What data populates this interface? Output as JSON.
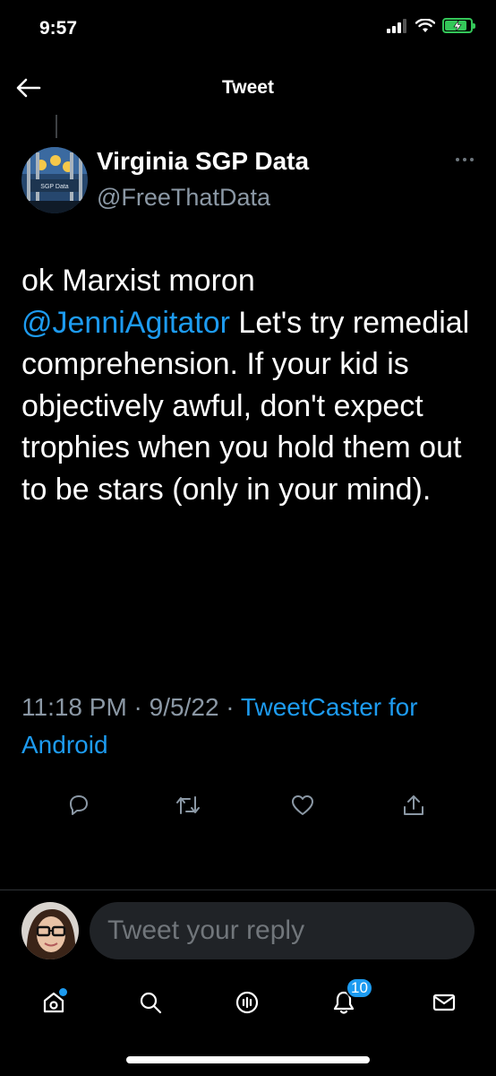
{
  "status_bar": {
    "time": "9:57",
    "icons": [
      "signal-icon",
      "wifi-icon",
      "battery-charging-icon"
    ],
    "battery_level": 0.8
  },
  "header": {
    "title": "Tweet",
    "back_icon": "arrow-left-icon"
  },
  "tweet": {
    "author_name": "Virginia SGP Data",
    "author_handle": "@FreeThatData",
    "avatar_label": "SGP Data",
    "text_before": "ok Marxist moron ",
    "mention": "@JenniAgitator",
    "text_after": " Let's try remedial comprehension. If your kid is objectively awful, don't expect trophies when you hold them out to be stars (only in your mind).",
    "time": "11:18 PM",
    "date": "9/5/22",
    "source": "TweetCaster for Android",
    "actions": [
      "reply-icon",
      "retweet-icon",
      "like-icon",
      "share-icon"
    ]
  },
  "reply": {
    "placeholder": "Tweet your reply"
  },
  "tabbar": {
    "items": [
      "home-icon",
      "search-icon",
      "spaces-icon",
      "notifications-icon",
      "messages-icon"
    ],
    "notification_count": "10"
  },
  "colors": {
    "accent": "#1d9bf0",
    "background": "#000000",
    "secondary_text": "#8b98a5",
    "battery": "#34c759"
  }
}
